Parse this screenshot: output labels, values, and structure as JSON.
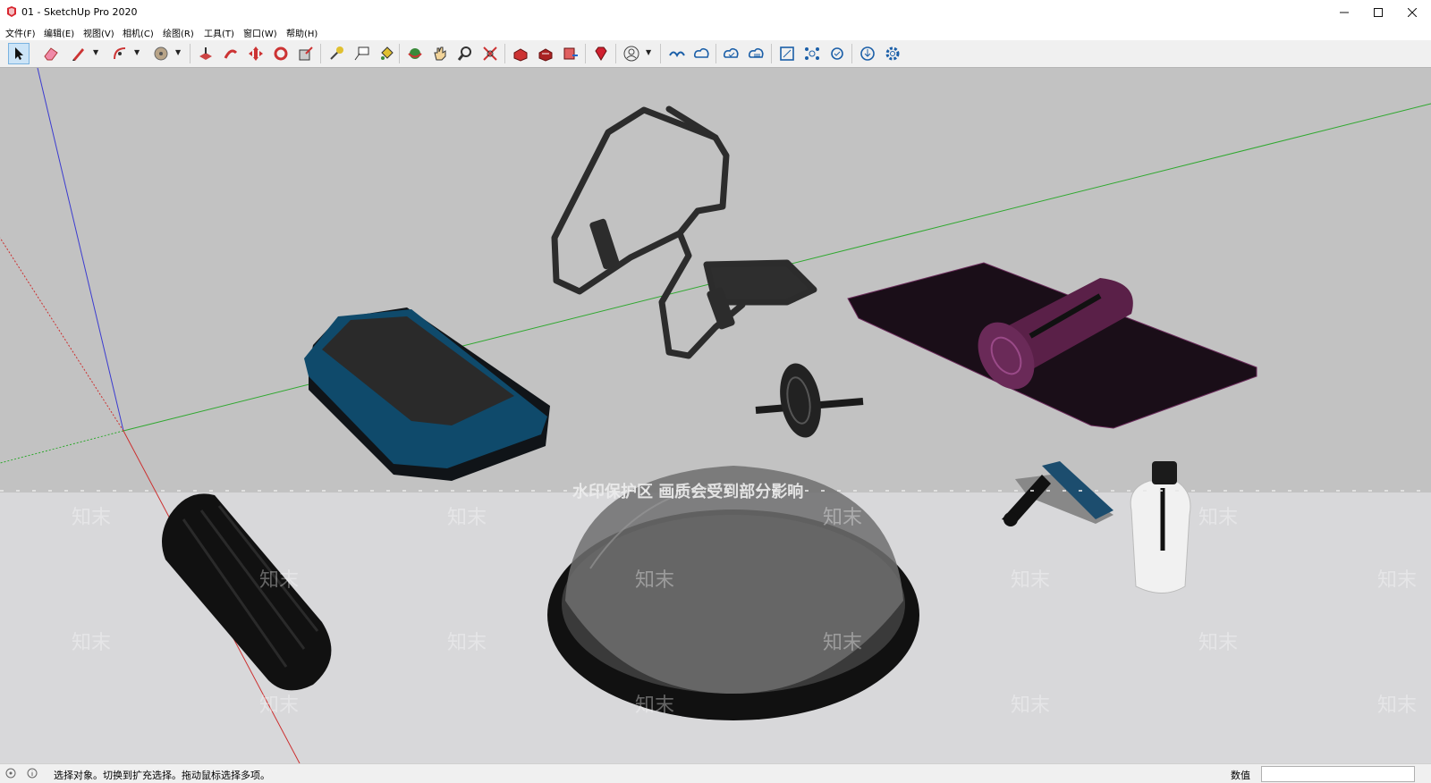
{
  "window": {
    "title": "01 - SketchUp Pro 2020"
  },
  "menu": {
    "items": [
      {
        "label": "文件(F)"
      },
      {
        "label": "编辑(E)"
      },
      {
        "label": "视图(V)"
      },
      {
        "label": "相机(C)"
      },
      {
        "label": "绘图(R)"
      },
      {
        "label": "工具(T)"
      },
      {
        "label": "窗口(W)"
      },
      {
        "label": "帮助(H)"
      }
    ]
  },
  "toolbar": {
    "tools": [
      "select",
      "eraser",
      "pencil",
      "arc",
      "paint-bucket",
      "push-pull",
      "follow-me",
      "move",
      "rotate",
      "scale",
      "tape-measure",
      "text",
      "paint",
      "orbit",
      "pan",
      "zoom",
      "zoom-extents",
      "warehouse",
      "extension-warehouse",
      "layout",
      "ruby",
      "account",
      "cloud-a",
      "cloud-b",
      "cloud-c",
      "cloud-d",
      "crop",
      "network",
      "sync",
      "download",
      "settings"
    ]
  },
  "viewport": {
    "watermark_main": "水印保护区 画质会受到部分影响",
    "watermark_tile": "知末"
  },
  "status": {
    "hint": "选择对象。切换到扩充选择。拖动鼠标选择多项。",
    "measure_label": "数值",
    "measure_value": ""
  },
  "colors": {
    "viewport_bg": "#c4c4c4",
    "step_blue": "#0f4a6b",
    "mat_purple": "#5a2048",
    "axis_green": "#2fa82f",
    "axis_blue": "#3b3bd0",
    "axis_red": "#cc3030"
  }
}
